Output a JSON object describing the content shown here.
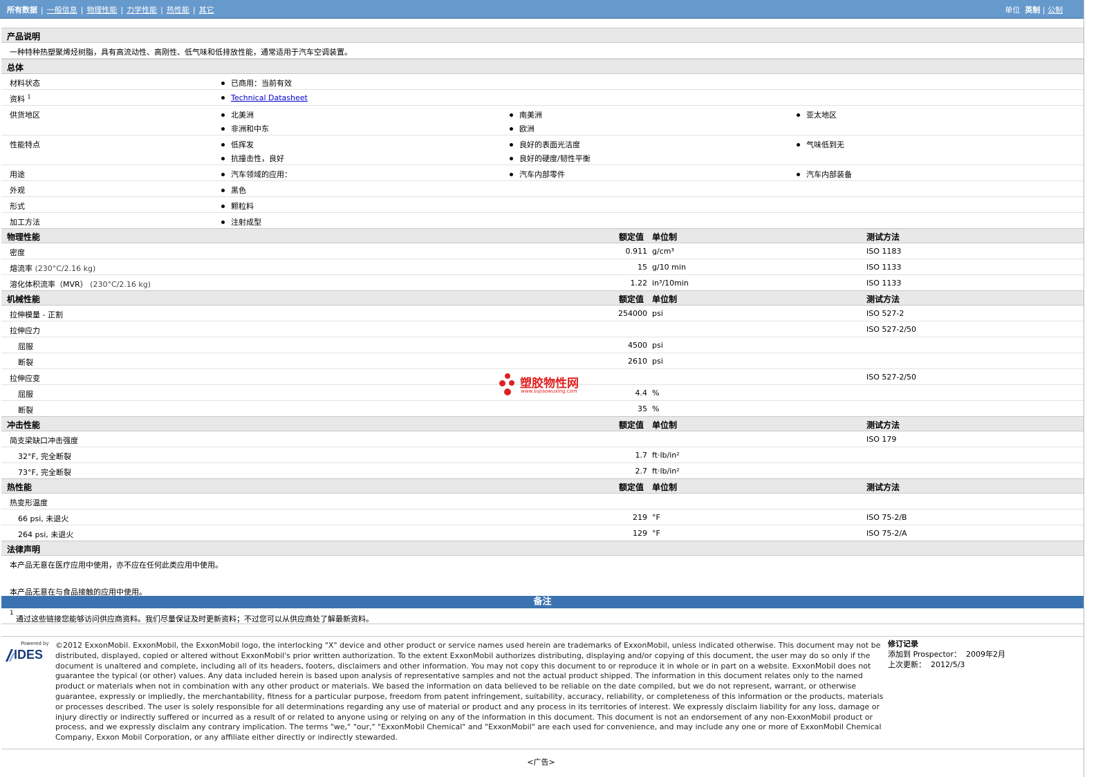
{
  "nav": {
    "items": [
      {
        "label": "所有数据",
        "active": true
      },
      {
        "label": "一般信息"
      },
      {
        "label": "物理性能"
      },
      {
        "label": "力学性能"
      },
      {
        "label": "热性能"
      },
      {
        "label": "其它"
      }
    ],
    "unit_label": "单位",
    "unit_english": "英制",
    "unit_metric": "公制"
  },
  "product": {
    "title": "产品说明",
    "description": "一种特种热塑聚烯烃树脂，具有高流动性、高刚性、低气味和低排放性能，通常适用于汽车空调装置。"
  },
  "general": {
    "title": "总体",
    "material_status": {
      "label": "材料状态",
      "value": "已商用：当前有效"
    },
    "resources": {
      "label": "资料",
      "sup": "1",
      "value": "Technical Datasheet"
    },
    "availability": {
      "label": "供货地区",
      "items": [
        "北美洲",
        "南美洲",
        "亚太地区",
        "非洲和中东",
        "欧洲"
      ]
    },
    "features": {
      "label": "性能特点",
      "items": [
        "低挥发",
        "良好的表面光洁度",
        "气味低到无",
        "抗撞击性，良好",
        "良好的硬度/韧性平衡"
      ]
    },
    "uses": {
      "label": "用途",
      "items": [
        "汽车领域的应用：",
        "汽车内部零件",
        "汽车内部装备"
      ]
    },
    "appearance": {
      "label": "外观",
      "value": "黑色"
    },
    "form": {
      "label": "形式",
      "value": "颗粒料"
    },
    "processing": {
      "label": "加工方法",
      "value": "注射成型"
    }
  },
  "headers": {
    "rated": "额定值",
    "unit": "单位制",
    "test": "测试方法"
  },
  "physical": {
    "title": "物理性能",
    "rows": [
      {
        "label": "密度",
        "value": "0.911",
        "unit": "g/cm³",
        "test": "ISO 1183"
      },
      {
        "label": "熔流率",
        "cond": "(230°C/2.16 kg)",
        "value": "15",
        "unit": "g/10 min",
        "test": "ISO 1133"
      },
      {
        "label": "溶化体积流率（MVR）",
        "cond": "(230°C/2.16 kg)",
        "value": "1.22",
        "unit": "in³/10min",
        "test": "ISO 1133"
      }
    ]
  },
  "mechanical": {
    "title": "机械性能",
    "modulus": {
      "label": "拉伸模量 - 正割",
      "value": "254000",
      "unit": "psi",
      "test": "ISO 527-2"
    },
    "stress": {
      "label": "拉伸应力",
      "test": "ISO 527-2/50",
      "yield_label": "屈服",
      "yield_value": "4500",
      "yield_unit": "psi",
      "break_label": "断裂",
      "break_value": "2610",
      "break_unit": "psi"
    },
    "strain": {
      "label": "拉伸应变",
      "test": "ISO 527-2/50",
      "yield_label": "屈服",
      "yield_value": "4.4",
      "yield_unit": "%",
      "break_label": "断裂",
      "break_value": "35",
      "break_unit": "%"
    }
  },
  "impact": {
    "title": "冲击性能",
    "charpy": {
      "label": "简支梁缺口冲击强度",
      "test": "ISO 179"
    },
    "rows": [
      {
        "label": "32°F, 完全断裂",
        "value": "1.7",
        "unit": "ft·lb/in²"
      },
      {
        "label": "73°F, 完全断裂",
        "value": "2.7",
        "unit": "ft·lb/in²"
      }
    ]
  },
  "thermal": {
    "title": "热性能",
    "hdt": {
      "label": "热变形温度"
    },
    "rows": [
      {
        "label": "66 psi, 未退火",
        "value": "219",
        "unit": "°F",
        "test": "ISO 75-2/B"
      },
      {
        "label": "264 psi, 未退火",
        "value": "129",
        "unit": "°F",
        "test": "ISO 75-2/A"
      }
    ]
  },
  "legal": {
    "title": "法律声明",
    "line1": "本产品无意在医疗应用中使用，亦不应在任何此类应用中使用。",
    "line2": "本产品无意在与食品接触的应用中使用。"
  },
  "notes": {
    "title": "备注",
    "sup": "1",
    "text": "通过这些链接您能够访问供应商资料。我们尽量保证及时更新资料；不过您可以从供应商处了解最新资料。"
  },
  "footer": {
    "powered_by": "Powered by",
    "ides": "IDES",
    "copyright": "©2012 ExxonMobil. ExxonMobil, the ExxonMobil logo, the interlocking \"X\" device and other product or service names used herein are trademarks of ExxonMobil, unless indicated otherwise. This document may not be distributed, displayed, copied or altered without ExxonMobil's prior written authorization. To the extent ExxonMobil authorizes distributing, displaying and/or copying of this document, the user may do so only if the document is unaltered and complete, including all of its headers, footers, disclaimers and other information. You may not copy this document to or reproduce it in whole or in part on a website. ExxonMobil does not guarantee the typical (or other) values. Any data included herein is based upon analysis of representative samples and not the actual product shipped. The information in this document relates only to the named product or materials when not in combination with any other product or materials. We based the information on data believed to be reliable on the date compiled, but we do not represent, warrant, or otherwise guarantee, expressly or impliedly, the merchantability, fitness for a particular purpose, freedom from patent infringement, suitability, accuracy, reliability, or completeness of this information or the products, materials or processes described. The user is solely responsible for all determinations regarding any use of material or product and any process in its territories of interest. We expressly disclaim liability for any loss, damage or injury directly or indirectly suffered or incurred as a result of or related to anyone using or relying on any of the information in this document. This document is not an endorsement of any non-ExxonMobil product or process, and we expressly disclaim any contrary implication. The terms \"we,\" \"our,\" \"ExxonMobil Chemical\" and \"ExxonMobil\" are each used for convenience, and may include any one or more of ExxonMobil Chemical Company, Exxon Mobil Corporation, or any affiliate either directly or indirectly stewarded.",
    "rev_title": "修订记录",
    "added_label": "添加到 Prospector：",
    "added_value": "2009年2月",
    "updated_label": "上次更新：",
    "updated_value": "2012/5/3",
    "ad": "<广告>"
  },
  "watermark": {
    "brand": "塑胶物性网",
    "url": "www.sujiaowuxing.com"
  }
}
